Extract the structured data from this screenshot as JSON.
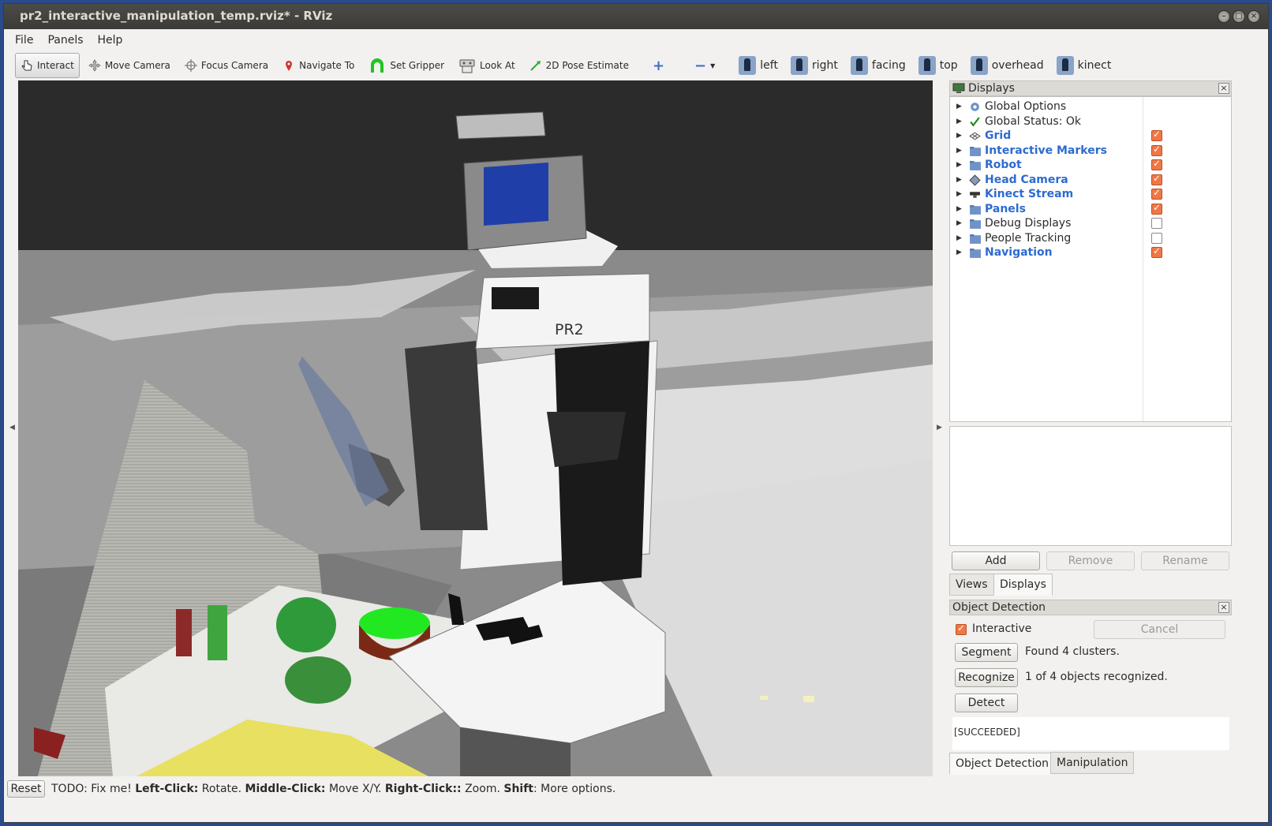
{
  "window": {
    "title": "pr2_interactive_manipulation_temp.rviz* - RViz"
  },
  "menu": {
    "items": [
      "File",
      "Panels",
      "Help"
    ]
  },
  "toolbar": {
    "tools": [
      {
        "label": "Interact",
        "icon": "hand-pointer-icon",
        "active": true
      },
      {
        "label": "Move Camera",
        "icon": "move-camera-icon"
      },
      {
        "label": "Focus Camera",
        "icon": "focus-camera-icon"
      },
      {
        "label": "Navigate To",
        "icon": "map-pin-icon"
      },
      {
        "label": "Set Gripper",
        "icon": "gripper-icon"
      },
      {
        "label": "Look At",
        "icon": "look-at-icon"
      },
      {
        "label": "2D Pose Estimate",
        "icon": "pose-arrow-icon"
      }
    ],
    "views": [
      "left",
      "right",
      "facing",
      "top",
      "overhead",
      "kinect"
    ]
  },
  "displays": {
    "title": "Displays",
    "items": [
      {
        "label": "Global Options",
        "icon": "gear-icon",
        "blue": false,
        "checkbox": null
      },
      {
        "label": "Global Status: Ok",
        "icon": "check-icon",
        "blue": false,
        "checkbox": null
      },
      {
        "label": "Grid",
        "icon": "grid-icon",
        "blue": true,
        "checkbox": true
      },
      {
        "label": "Interactive Markers",
        "icon": "folder-icon",
        "blue": true,
        "checkbox": true
      },
      {
        "label": "Robot",
        "icon": "folder-icon",
        "blue": true,
        "checkbox": true
      },
      {
        "label": "Head Camera",
        "icon": "camera-diamond-icon",
        "blue": true,
        "checkbox": true
      },
      {
        "label": "Kinect Stream",
        "icon": "kinect-icon",
        "blue": true,
        "checkbox": true
      },
      {
        "label": "Panels",
        "icon": "folder-icon",
        "blue": true,
        "checkbox": true
      },
      {
        "label": "Debug Displays",
        "icon": "folder-icon",
        "blue": false,
        "checkbox": false
      },
      {
        "label": "People Tracking",
        "icon": "folder-icon",
        "blue": false,
        "checkbox": false
      },
      {
        "label": "Navigation",
        "icon": "folder-icon",
        "blue": true,
        "checkbox": true
      }
    ],
    "buttons": {
      "add": "Add",
      "remove": "Remove",
      "rename": "Rename"
    },
    "tabs": {
      "views": "Views",
      "displays": "Displays"
    }
  },
  "object_detection": {
    "title": "Object Detection",
    "interactive_label": "Interactive",
    "interactive_checked": true,
    "cancel": "Cancel",
    "segment": "Segment",
    "segment_status": "Found 4 clusters.",
    "recognize": "Recognize",
    "recognize_status": "1 of 4 objects recognized.",
    "detect": "Detect",
    "result": "[SUCCEEDED]",
    "tabs": {
      "object_detection": "Object Detection",
      "manipulation": "Manipulation"
    }
  },
  "viewport": {
    "robot_label": "PR2"
  },
  "status": {
    "reset": "Reset",
    "prefix": "TODO: Fix me! ",
    "k1": "Left-Click:",
    "v1": " Rotate. ",
    "k2": "Middle-Click:",
    "v2": " Move X/Y. ",
    "k3": "Right-Click::",
    "v3": " Zoom. ",
    "k4": "Shift",
    "v4": ": More options."
  }
}
